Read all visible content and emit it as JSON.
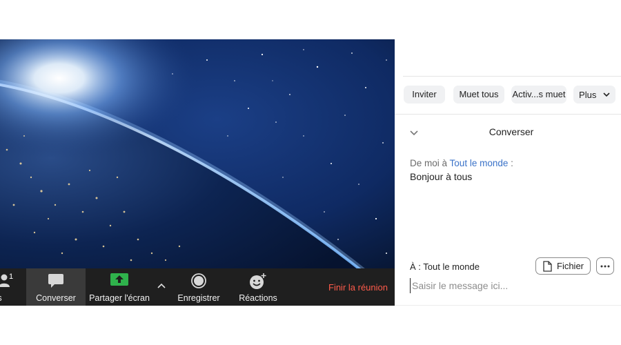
{
  "toolbar": {
    "participants_label": "pants",
    "participants_count": "1",
    "chat_label": "Converser",
    "share_label": "Partager l'écran",
    "record_label": "Enregistrer",
    "reactions_label": "Réactions",
    "end_label": "Finir la réunion"
  },
  "panel": {
    "buttons": {
      "invite": "Inviter",
      "mute_all": "Muet tous",
      "unmute_all": "Activ...s muet",
      "more": "Plus"
    },
    "chat_title": "Converser",
    "messages": [
      {
        "from_prefix": "De moi à",
        "to": "Tout le monde",
        "suffix": ":",
        "text": "Bonjour à tous"
      }
    ],
    "send_to": "À : Tout le monde",
    "file_label": "Fichier",
    "input_placeholder": "Saisir le message ici..."
  },
  "colors": {
    "toolbar_bg": "#1f1f1f",
    "active_tab_bg": "#3a3a3a",
    "share_green": "#2fb24c",
    "end_red": "#ff5b4a",
    "link_blue": "#3a72c8"
  },
  "icons": {
    "participants": "person-icon",
    "chat": "chat-bubble-icon",
    "share": "share-screen-icon",
    "caret": "chevron-up-icon",
    "record": "record-icon",
    "reactions": "emoji-add-icon",
    "more": "chevron-down-icon",
    "collapse": "chevron-down-icon",
    "file": "file-icon",
    "overflow": "more-horizontal-icon"
  }
}
